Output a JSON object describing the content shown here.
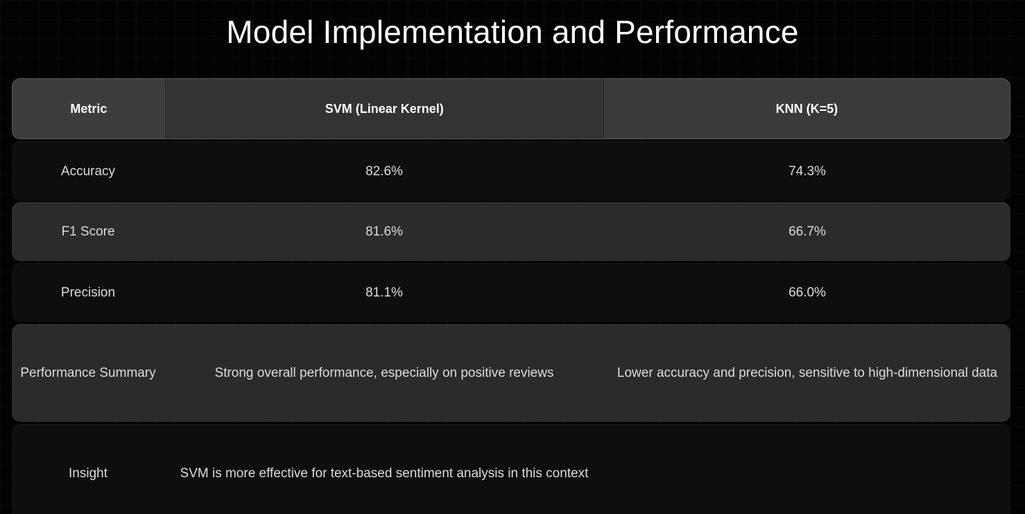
{
  "title": "Model Implementation and Performance",
  "table": {
    "headers": [
      "Metric",
      "SVM (Linear Kernel)",
      "KNN (K=5)"
    ],
    "rows": [
      [
        "Accuracy",
        "82.6%",
        "74.3%"
      ],
      [
        "F1 Score",
        "81.6%",
        "66.7%"
      ],
      [
        "Precision",
        "81.1%",
        "66.0%"
      ],
      [
        "Performance Summary",
        "Strong overall performance, especially on positive reviews",
        "Lower accuracy and precision, sensitive to high-dimensional data"
      ],
      [
        "Insight",
        "SVM is more effective for text-based sentiment analysis in this context",
        ""
      ]
    ]
  },
  "colors": {
    "background": "#020202",
    "header_row": "#3a3a3a",
    "row_dark": "#0e0e0e",
    "row_light": "#2b2b2b",
    "text": "#dcdcdc"
  }
}
